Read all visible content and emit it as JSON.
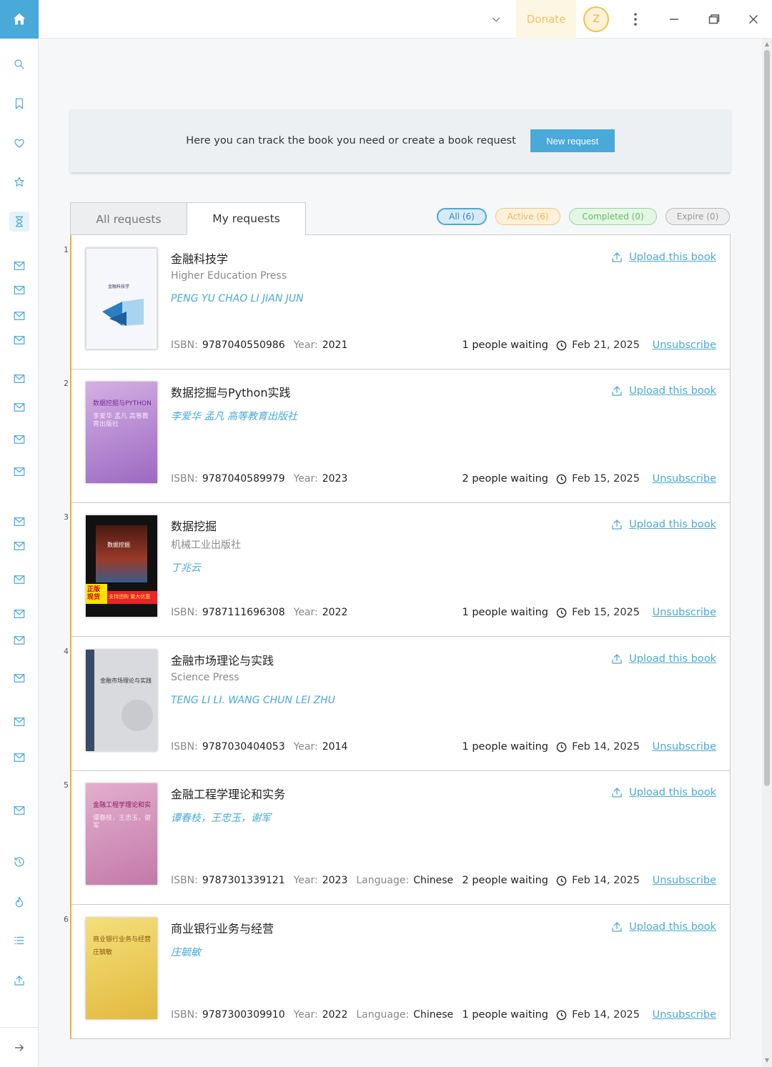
{
  "topbar": {
    "donate_label": "Donate",
    "avatar_letter": "Z"
  },
  "banner": {
    "text": "Here you can track the book you need or create a book request",
    "button_label": "New request"
  },
  "tabs": [
    {
      "label": "All requests"
    },
    {
      "label": "My requests"
    }
  ],
  "filters": {
    "all": "All (6)",
    "active": "Active (6)",
    "completed": "Completed (0)",
    "expire": "Expire (0)"
  },
  "labels": {
    "isbn": "ISBN:",
    "year": "Year:",
    "language": "Language:",
    "upload": "Upload this book",
    "unsubscribe": "Unsubscribe"
  },
  "books": [
    {
      "num": "1",
      "title": "金融科技学",
      "publisher": "Higher Education Press",
      "authors": "PENG YU CHAO LI JIAN JUN",
      "isbn": "9787040550986",
      "year": "2021",
      "waiting": "1 people waiting",
      "date": "Feb 21, 2025",
      "cover_text": "金融科技学"
    },
    {
      "num": "2",
      "title": "数据挖掘与Python实践",
      "authors": "李爱华 孟凡 高等教育出版社",
      "isbn": "9787040589979",
      "year": "2023",
      "waiting": "2 people waiting",
      "date": "Feb 15, 2025",
      "cover_text": "数据挖掘与PYTHON",
      "cover_sub": "李爱华 孟凡 高等教育出版社"
    },
    {
      "num": "3",
      "title": "数据挖掘",
      "publisher": "机械工业出版社",
      "authors": "丁兆云",
      "isbn": "9787111696308",
      "year": "2022",
      "waiting": "1 people waiting",
      "date": "Feb 15, 2025",
      "cover_text": "数据挖掘",
      "cover_badge": "正版现货",
      "cover_strip": "支持团购 量大优惠"
    },
    {
      "num": "4",
      "title": "金融市场理论与实践",
      "publisher": "Science Press",
      "authors": "TENG LI LI. WANG CHUN LEI ZHU",
      "isbn": "9787030404053",
      "year": "2014",
      "waiting": "1 people waiting",
      "date": "Feb 14, 2025",
      "cover_text": "金融市场理论与实践"
    },
    {
      "num": "5",
      "title": "金融工程学理论和实务",
      "authors": "谭春枝，王忠玉，谢军",
      "isbn": "9787301339121",
      "year": "2023",
      "language": "Chinese",
      "waiting": "2 people waiting",
      "date": "Feb 14, 2025",
      "cover_text": "金融工程学理论和实",
      "cover_sub": "谭春枝，王忠玉，谢军"
    },
    {
      "num": "6",
      "title": "商业银行业务与经营",
      "authors": "庄毓敏",
      "isbn": "9787300309910",
      "year": "2022",
      "language": "Chinese",
      "waiting": "1 people waiting",
      "date": "Feb 14, 2025",
      "cover_text": "商业银行业务与经营",
      "cover_sub": "庄毓敏"
    }
  ],
  "icons": {
    "sidebar": [
      "home-icon",
      "search-icon",
      "bookmark-icon",
      "heart-icon",
      "star-badge-icon",
      "hourglass-icon",
      "mail-icon",
      "clock-history-icon",
      "flame-icon",
      "list-icon",
      "upload-icon",
      "arrow-right-icon"
    ],
    "accent_color": "#49a9d8"
  }
}
